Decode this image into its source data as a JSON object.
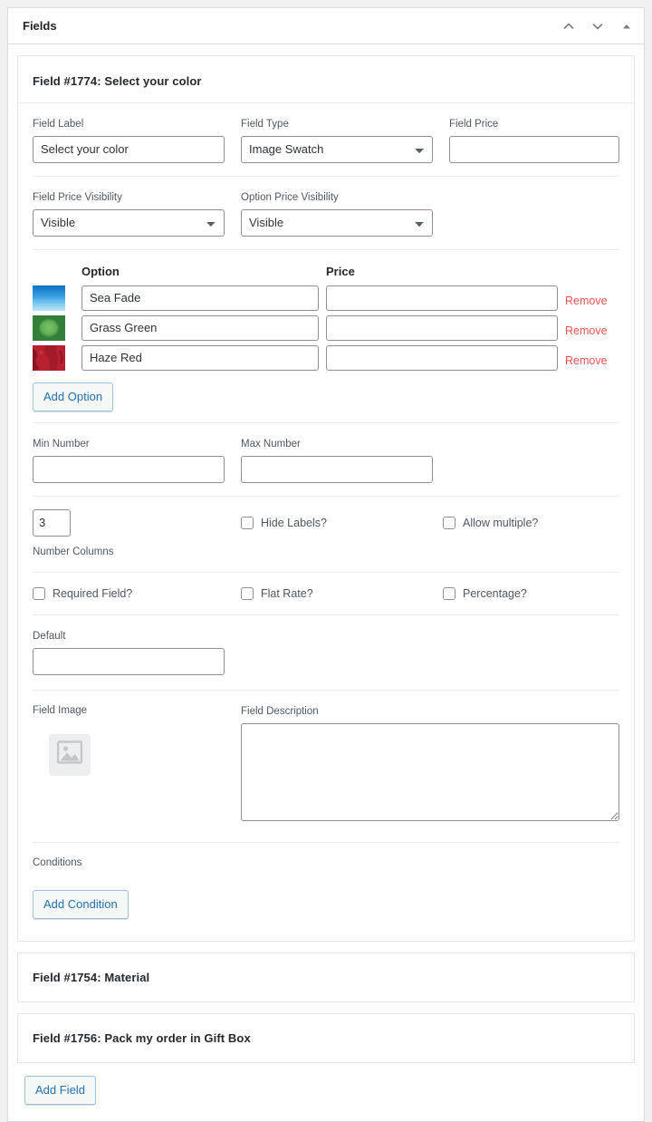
{
  "metabox": {
    "title": "Fields",
    "actions": [
      {
        "name": "move-up",
        "icon": "chevron-up-icon"
      },
      {
        "name": "move-down",
        "icon": "chevron-down-icon"
      },
      {
        "name": "toggle-panel",
        "icon": "triangle-up-icon"
      }
    ]
  },
  "field": {
    "header": "Field #1774: Select your color",
    "labels": {
      "field_label": "Field Label",
      "field_type": "Field Type",
      "field_price": "Field Price",
      "field_price_visibility": "Field Price Visibility",
      "option_price_visibility": "Option Price Visibility",
      "min_number": "Min Number",
      "max_number": "Max Number",
      "number_columns": "Number Columns",
      "default": "Default",
      "field_image": "Field Image",
      "field_description": "Field Description",
      "conditions": "Conditions"
    },
    "values": {
      "field_label": "Select your color",
      "field_type": "Image Swatch",
      "field_price": "",
      "field_price_visibility": "Visible",
      "option_price_visibility": "Visible",
      "min_number": "",
      "max_number": "",
      "number_columns": "3",
      "default": "",
      "field_description": ""
    },
    "select_options": {
      "field_type": [
        "Image Swatch"
      ],
      "field_price_visibility": [
        "Visible"
      ],
      "option_price_visibility": [
        "Visible"
      ]
    },
    "options_table": {
      "col_option": "Option",
      "col_price": "Price",
      "remove_label": "Remove",
      "rows": [
        {
          "name": "Sea Fade",
          "price": "",
          "swatch": "sea-fade-swatch",
          "color_top": "#0a74c4",
          "color_bottom": "#9fd6f2"
        },
        {
          "name": "Grass Green",
          "price": "",
          "swatch": "grass-green-swatch",
          "color_top": "#3d8c40",
          "color_bottom": "#6cbf63"
        },
        {
          "name": "Haze Red",
          "price": "",
          "swatch": "haze-red-swatch",
          "color_top": "#8f1420",
          "color_bottom": "#c4303c"
        }
      ],
      "add_option_label": "Add Option"
    },
    "checkboxes": [
      {
        "label": "Hide Labels?",
        "checked": false,
        "name": "hide-labels"
      },
      {
        "label": "Allow multiple?",
        "checked": false,
        "name": "allow-multiple"
      },
      {
        "label": "Required Field?",
        "checked": false,
        "name": "required-field"
      },
      {
        "label": "Flat Rate?",
        "checked": false,
        "name": "flat-rate"
      },
      {
        "label": "Percentage?",
        "checked": false,
        "name": "percentage"
      }
    ],
    "add_condition_label": "Add Condition"
  },
  "collapsed_fields": [
    {
      "header": "Field #1754: Material"
    },
    {
      "header": "Field #1756: Pack my order in Gift Box"
    }
  ],
  "footer": {
    "add_field_label": "Add Field"
  },
  "colors": {
    "accent_blue": "#2271b1",
    "remove_red": "#f05353",
    "label_gray": "#50575e",
    "border_gray": "#8c8f94",
    "panel_border": "#e5e5e5"
  }
}
